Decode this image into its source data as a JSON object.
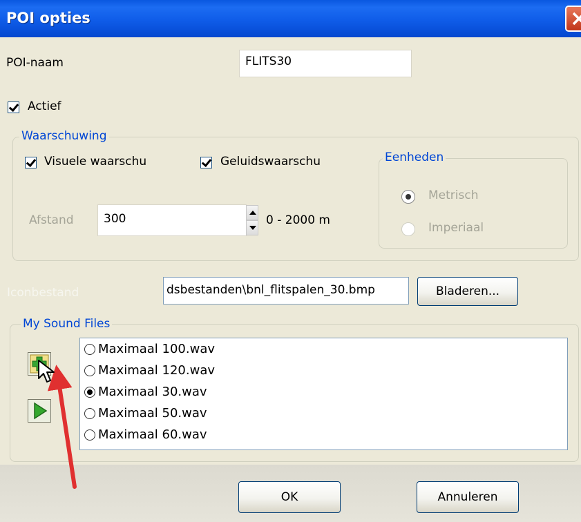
{
  "window": {
    "title": "POI opties"
  },
  "poi_name": {
    "label": "POI-naam",
    "value": "FLITS30"
  },
  "active": {
    "label": "Actief",
    "checked": true
  },
  "warning": {
    "legend": "Waarschuwing",
    "visual": {
      "label": "Visuele waarschu",
      "checked": true
    },
    "sound": {
      "label": "Geluidswaarschu",
      "checked": true
    },
    "distance": {
      "label": "Afstand",
      "value": "300",
      "range": "0 - 2000 m"
    },
    "units": {
      "legend": "Eenheden",
      "options": [
        {
          "label": "Metrisch",
          "selected": true
        },
        {
          "label": "Imperiaal",
          "selected": false
        }
      ]
    }
  },
  "icon_file": {
    "label": "Iconbestand",
    "value": "dsbestanden\\bnl_flitspalen_30.bmp",
    "browse_label": "Bladeren..."
  },
  "sound_files": {
    "legend": "My Sound Files",
    "items": [
      {
        "label": "Maximaal 100.wav",
        "selected": false
      },
      {
        "label": "Maximaal 120.wav",
        "selected": false
      },
      {
        "label": "Maximaal 30.wav",
        "selected": true
      },
      {
        "label": "Maximaal 50.wav",
        "selected": false
      },
      {
        "label": "Maximaal 60.wav",
        "selected": false
      }
    ]
  },
  "buttons": {
    "ok": "OK",
    "cancel": "Annuleren"
  },
  "colors": {
    "titlebar": "#0a58e0",
    "dialog_bg": "#ece9d8",
    "group_legend": "#0046d5",
    "annotation_arrow": "#e03030"
  },
  "icons": [
    "close-icon",
    "add-sound-icon",
    "play-icon",
    "annotation-arrow"
  ]
}
